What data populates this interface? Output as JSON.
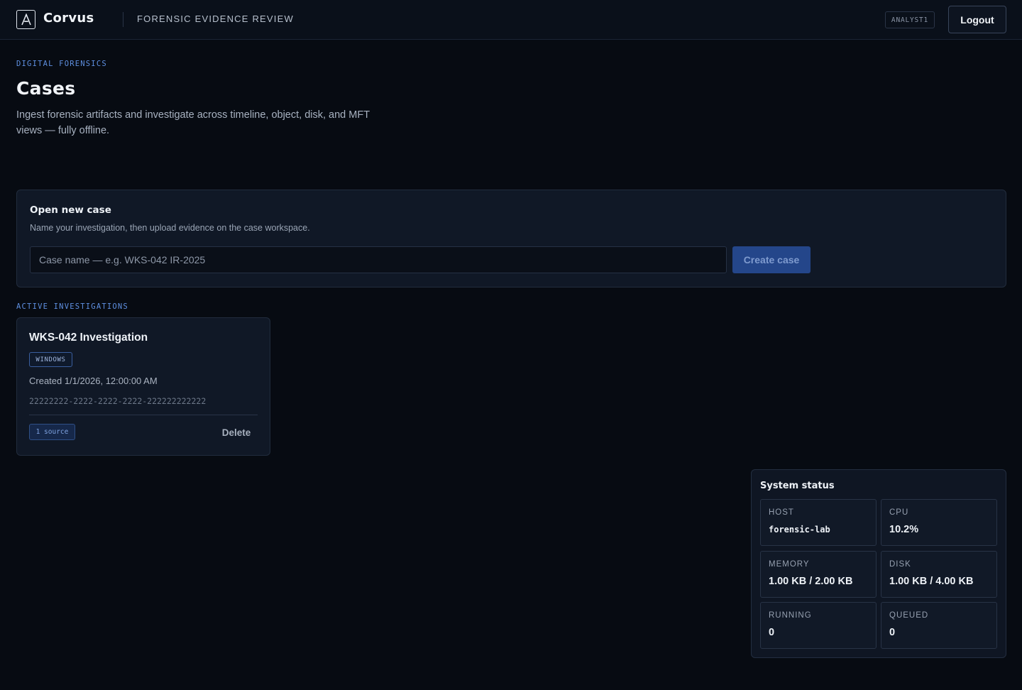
{
  "header": {
    "brand": "Corvus",
    "app_title": "FORENSIC EVIDENCE REVIEW",
    "user": "ANALYST1",
    "logout_label": "Logout"
  },
  "page": {
    "eyebrow": "DIGITAL FORENSICS",
    "title": "Cases",
    "description": "Ingest forensic artifacts and investigate across timeline, object, disk, and MFT views — fully offline."
  },
  "new_case": {
    "title": "Open new case",
    "subtitle": "Name your investigation, then upload evidence on the case workspace.",
    "input_placeholder": "Case name — e.g. WKS-042 IR-2025",
    "input_value": "",
    "create_label": "Create case"
  },
  "investigations": {
    "section_label": "ACTIVE INVESTIGATIONS",
    "cases": [
      {
        "name": "WKS-042 Investigation",
        "os": "WINDOWS",
        "created": "Created 1/1/2026, 12:00:00 AM",
        "id": "22222222-2222-2222-2222-222222222222",
        "sources": "1 source",
        "delete_label": "Delete"
      }
    ]
  },
  "system_status": {
    "title": "System status",
    "host_label": "HOST",
    "host_value": "forensic-lab",
    "cpu_label": "CPU",
    "cpu_value": "10.2%",
    "memory_label": "MEMORY",
    "memory_value": "1.00 KB / 2.00 KB",
    "disk_label": "DISK",
    "disk_value": "1.00 KB / 4.00 KB",
    "running_label": "RUNNING",
    "running_value": "0",
    "queued_label": "QUEUED",
    "queued_value": "0"
  },
  "colors": {
    "background": "#070b12",
    "accent": "#5e8fe0",
    "primary_button": "#24468a"
  }
}
